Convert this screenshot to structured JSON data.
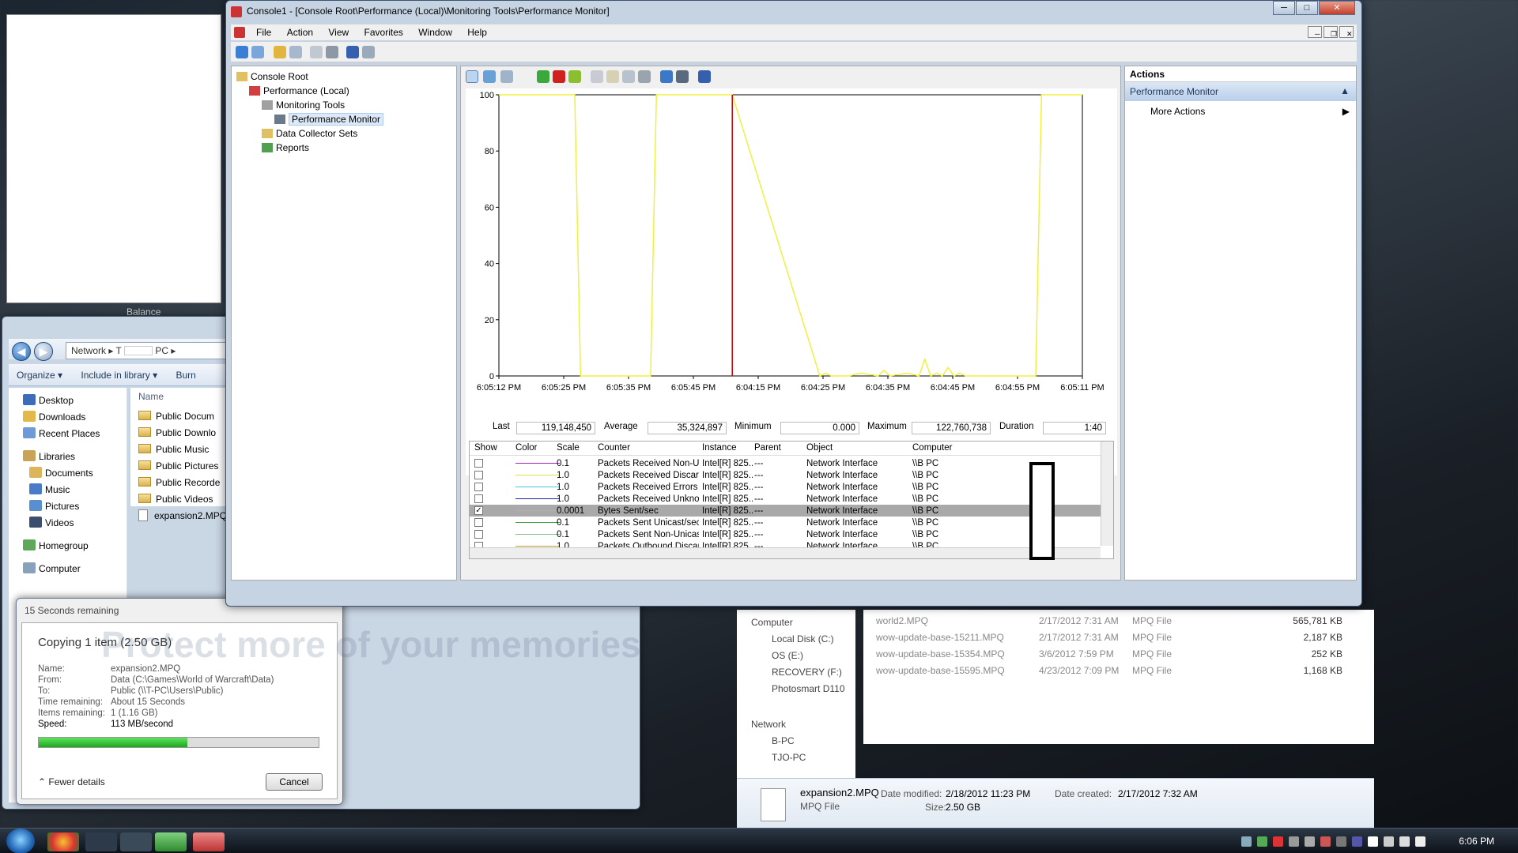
{
  "gadget": {
    "caption": "Balance"
  },
  "explorer_left": {
    "breadcrumb": [
      "Network",
      "T",
      "PC"
    ],
    "commands": [
      "Organize ▾",
      "Include in library ▾",
      "Burn"
    ],
    "nav": [
      {
        "label": "Desktop",
        "color": "#3d6cb8"
      },
      {
        "label": "Downloads",
        "color": "#e3b94a"
      },
      {
        "label": "Recent Places",
        "color": "#6e9bd6"
      },
      {
        "label": "Libraries",
        "color": "#c7a257"
      },
      {
        "label": "Documents",
        "color": "#dcb55a"
      },
      {
        "label": "Music",
        "color": "#4b7bc7"
      },
      {
        "label": "Pictures",
        "color": "#5a8fcf"
      },
      {
        "label": "Videos",
        "color": "#3b4e6e"
      },
      {
        "label": "Homegroup",
        "color": "#5da85a"
      },
      {
        "label": "Computer",
        "color": "#8aa1bb"
      }
    ],
    "list_header": "Name",
    "files": [
      "Public Docum",
      "Public Downlo",
      "Public Music",
      "Public Pictures",
      "Public Recorde",
      "Public Videos",
      "expansion2.MPQ"
    ]
  },
  "explorer_right": {
    "nav": [
      "Computer",
      "Local Disk (C:)",
      "OS (E:)",
      "RECOVERY (F:)",
      "Photosmart D110",
      "Network",
      "B-PC",
      "TJO-PC"
    ],
    "files": [
      {
        "name": "world2.MPQ",
        "date": "2/17/2012 7:31 AM",
        "type": "MPQ File",
        "size": "565,781 KB"
      },
      {
        "name": "wow-update-base-15211.MPQ",
        "date": "2/17/2012 7:31 AM",
        "type": "MPQ File",
        "size": "2,187 KB"
      },
      {
        "name": "wow-update-base-15354.MPQ",
        "date": "3/6/2012 7:59 PM",
        "type": "MPQ File",
        "size": "252 KB"
      },
      {
        "name": "wow-update-base-15595.MPQ",
        "date": "4/23/2012 7:09 PM",
        "type": "MPQ File",
        "size": "1,168 KB"
      }
    ],
    "details": {
      "name": "expansion2.MPQ",
      "type": "MPQ File",
      "modified_label": "Date modified:",
      "modified": "2/18/2012 11:23 PM",
      "size_label": "Size:",
      "size": "2.50 GB",
      "created_label": "Date created:",
      "created": "2/17/2012 7:32 AM"
    }
  },
  "copy_dialog": {
    "title": "15 Seconds remaining",
    "heading": "Copying 1 item (2.50 GB)",
    "rows": [
      {
        "k": "Name:",
        "v": "expansion2.MPQ"
      },
      {
        "k": "From:",
        "v": "Data (C:\\Games\\World of Warcraft\\Data)"
      },
      {
        "k": "To:",
        "v": "Public (\\\\T-PC\\Users\\Public)"
      },
      {
        "k": "Time remaining:",
        "v": "About 15 Seconds"
      },
      {
        "k": "Items remaining:",
        "v": "1 (1.16 GB)"
      },
      {
        "k": "Speed:",
        "v": "113 MB/second"
      }
    ],
    "progress": 0.53,
    "fewer": "Fewer details",
    "cancel": "Cancel",
    "watermark": "Protect more of your memories"
  },
  "mmc": {
    "title": "Console1 - [Console Root\\Performance (Local)\\Monitoring Tools\\Performance Monitor]",
    "menu": [
      "File",
      "Action",
      "View",
      "Favorites",
      "Window",
      "Help"
    ],
    "tree": [
      {
        "label": "Console Root",
        "indent": 0
      },
      {
        "label": "Performance (Local)",
        "indent": 1
      },
      {
        "label": "Monitoring Tools",
        "indent": 2
      },
      {
        "label": "Performance Monitor",
        "indent": 3
      },
      {
        "label": "Data Collector Sets",
        "indent": 2
      },
      {
        "label": "Reports",
        "indent": 2
      }
    ],
    "actions": {
      "header": "Actions",
      "section": "Performance Monitor",
      "item": "More Actions"
    },
    "stats": {
      "last_label": "Last",
      "last": "119,148,450",
      "avg_label": "Average",
      "avg": "35,324,897",
      "min_label": "Minimum",
      "min": "0.000",
      "max_label": "Maximum",
      "max": "122,760,738",
      "dur_label": "Duration",
      "dur": "1:40"
    },
    "legend_headers": [
      "Show",
      "Color",
      "Scale",
      "Counter",
      "Instance",
      "Parent",
      "Object",
      "Computer"
    ],
    "legend_rows": [
      {
        "show": false,
        "color": "#a020c0",
        "scale": "0.1",
        "counter": "Packets Received Non-Unic...",
        "instance": "Intel[R] 825...",
        "parent": "---",
        "object": "Network Interface",
        "computer": "\\\\B PC"
      },
      {
        "show": false,
        "color": "#e0e040",
        "scale": "1.0",
        "counter": "Packets Received Discarded",
        "instance": "Intel[R] 825...",
        "parent": "---",
        "object": "Network Interface",
        "computer": "\\\\B PC"
      },
      {
        "show": false,
        "color": "#40c8e0",
        "scale": "1.0",
        "counter": "Packets Received Errors",
        "instance": "Intel[R] 825...",
        "parent": "---",
        "object": "Network Interface",
        "computer": "\\\\B PC"
      },
      {
        "show": false,
        "color": "#2020a0",
        "scale": "1.0",
        "counter": "Packets Received Unknown",
        "instance": "Intel[R] 825...",
        "parent": "---",
        "object": "Network Interface",
        "computer": "\\\\B PC"
      },
      {
        "show": true,
        "color": "#b0b0b0",
        "scale": "0.0001",
        "counter": "Bytes Sent/sec",
        "instance": "Intel[R] 825...",
        "parent": "---",
        "object": "Network Interface",
        "computer": "\\\\B PC",
        "highlight": true
      },
      {
        "show": false,
        "color": "#40a040",
        "scale": "0.1",
        "counter": "Packets Sent Unicast/sec",
        "instance": "Intel[R] 825...",
        "parent": "---",
        "object": "Network Interface",
        "computer": "\\\\B PC"
      },
      {
        "show": false,
        "color": "#80c080",
        "scale": "0.1",
        "counter": "Packets Sent Non-Unicast/...",
        "instance": "Intel[R] 825...",
        "parent": "---",
        "object": "Network Interface",
        "computer": "\\\\B PC"
      },
      {
        "show": false,
        "color": "#c0a020",
        "scale": "1.0",
        "counter": "Packets Outbound Discarded",
        "instance": "Intel[R] 825...",
        "parent": "---",
        "object": "Network Interface",
        "computer": "\\\\B PC"
      }
    ]
  },
  "chart_data": {
    "type": "line",
    "ylim": [
      0,
      100
    ],
    "yticks": [
      0,
      20,
      40,
      60,
      80,
      100
    ],
    "xticks": [
      "6:05:12 PM",
      "6:05:25 PM",
      "6:05:35 PM",
      "6:05:45 PM",
      "6:04:15 PM",
      "6:04:25 PM",
      "6:04:35 PM",
      "6:04:45 PM",
      "6:04:55 PM",
      "6:05:11 PM"
    ],
    "series": [
      {
        "color": "#f0f040",
        "x": [
          0,
          13,
          14,
          26,
          27,
          40,
          55,
          56,
          57,
          60,
          62,
          65,
          66,
          67,
          70,
          72,
          73,
          74,
          75,
          76,
          77,
          78,
          79,
          80,
          92,
          93,
          100
        ],
        "values": [
          100,
          100,
          0,
          0,
          100,
          100,
          0,
          1,
          0,
          0,
          1,
          0,
          2,
          0,
          1,
          0,
          6,
          0,
          1,
          0,
          3,
          0,
          1,
          0,
          0,
          100,
          100
        ]
      }
    ],
    "cursor_x": 40
  },
  "taskbar": {
    "clock": "6:06 PM"
  }
}
